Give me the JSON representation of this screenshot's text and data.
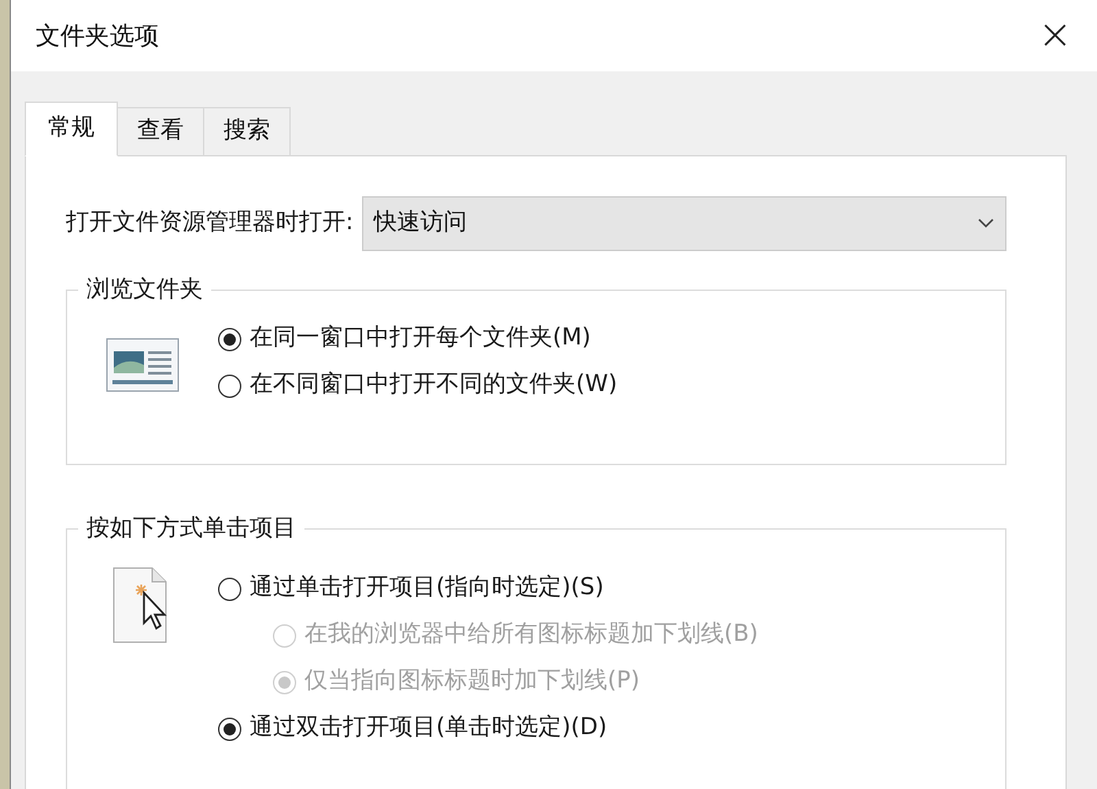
{
  "window": {
    "title": "文件夹选项",
    "close": "×"
  },
  "tabs": [
    {
      "label": "常规",
      "selected": true
    },
    {
      "label": "查看",
      "selected": false
    },
    {
      "label": "搜索",
      "selected": false
    }
  ],
  "open_explorer": {
    "label": "打开文件资源管理器时打开:",
    "value": "快速访问"
  },
  "groups": [
    {
      "title": "浏览文件夹",
      "options": [
        {
          "label": "在同一窗口中打开每个文件夹(M)",
          "selected": true,
          "disabled": false
        },
        {
          "label": "在不同窗口中打开不同的文件夹(W)",
          "selected": false,
          "disabled": false
        }
      ]
    },
    {
      "title": "按如下方式单击项目",
      "options": [
        {
          "label": "通过单击打开项目(指向时选定)(S)",
          "selected": false,
          "disabled": false,
          "children": [
            {
              "label": "在我的浏览器中给所有图标标题加下划线(B)",
              "selected": false,
              "disabled": true
            },
            {
              "label": "仅当指向图标标题时加下划线(P)",
              "selected": true,
              "disabled": true
            }
          ]
        },
        {
          "label": "通过双击打开项目(单击时选定)(D)",
          "selected": true,
          "disabled": false
        }
      ]
    }
  ]
}
